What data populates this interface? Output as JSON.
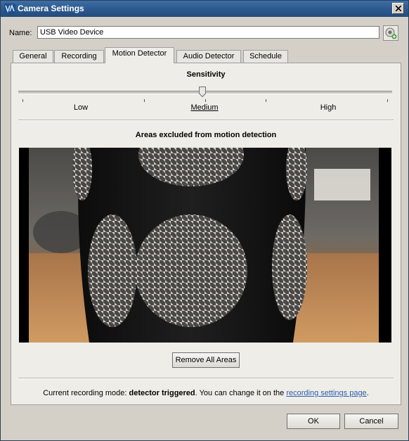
{
  "window": {
    "title": "Camera Settings",
    "app_icon": "app-icon",
    "close_icon": "close-icon"
  },
  "name_field": {
    "label": "Name:",
    "value": "USB Video Device",
    "snapshot_icon": "webcam-snapshot-icon"
  },
  "tabs": [
    {
      "label": "General",
      "active": false
    },
    {
      "label": "Recording",
      "active": false
    },
    {
      "label": "Motion Detector",
      "active": true
    },
    {
      "label": "Audio Detector",
      "active": false
    },
    {
      "label": "Schedule",
      "active": false
    }
  ],
  "sensitivity": {
    "title": "Sensitivity",
    "levels": [
      "Low",
      "Medium",
      "High"
    ],
    "selected": "Medium"
  },
  "excluded_areas": {
    "title": "Areas excluded from motion detection",
    "remove_label": "Remove All Areas"
  },
  "status": {
    "prefix": "Current recording mode: ",
    "mode": "detector triggered",
    "middle": ". You can change it on the ",
    "link": "recording settings page",
    "suffix": "."
  },
  "buttons": {
    "ok": "OK",
    "cancel": "Cancel"
  },
  "colors": {
    "titlebar": "#2d5a8f",
    "dialog": "#d4d0c8",
    "link": "#2a5db0"
  }
}
